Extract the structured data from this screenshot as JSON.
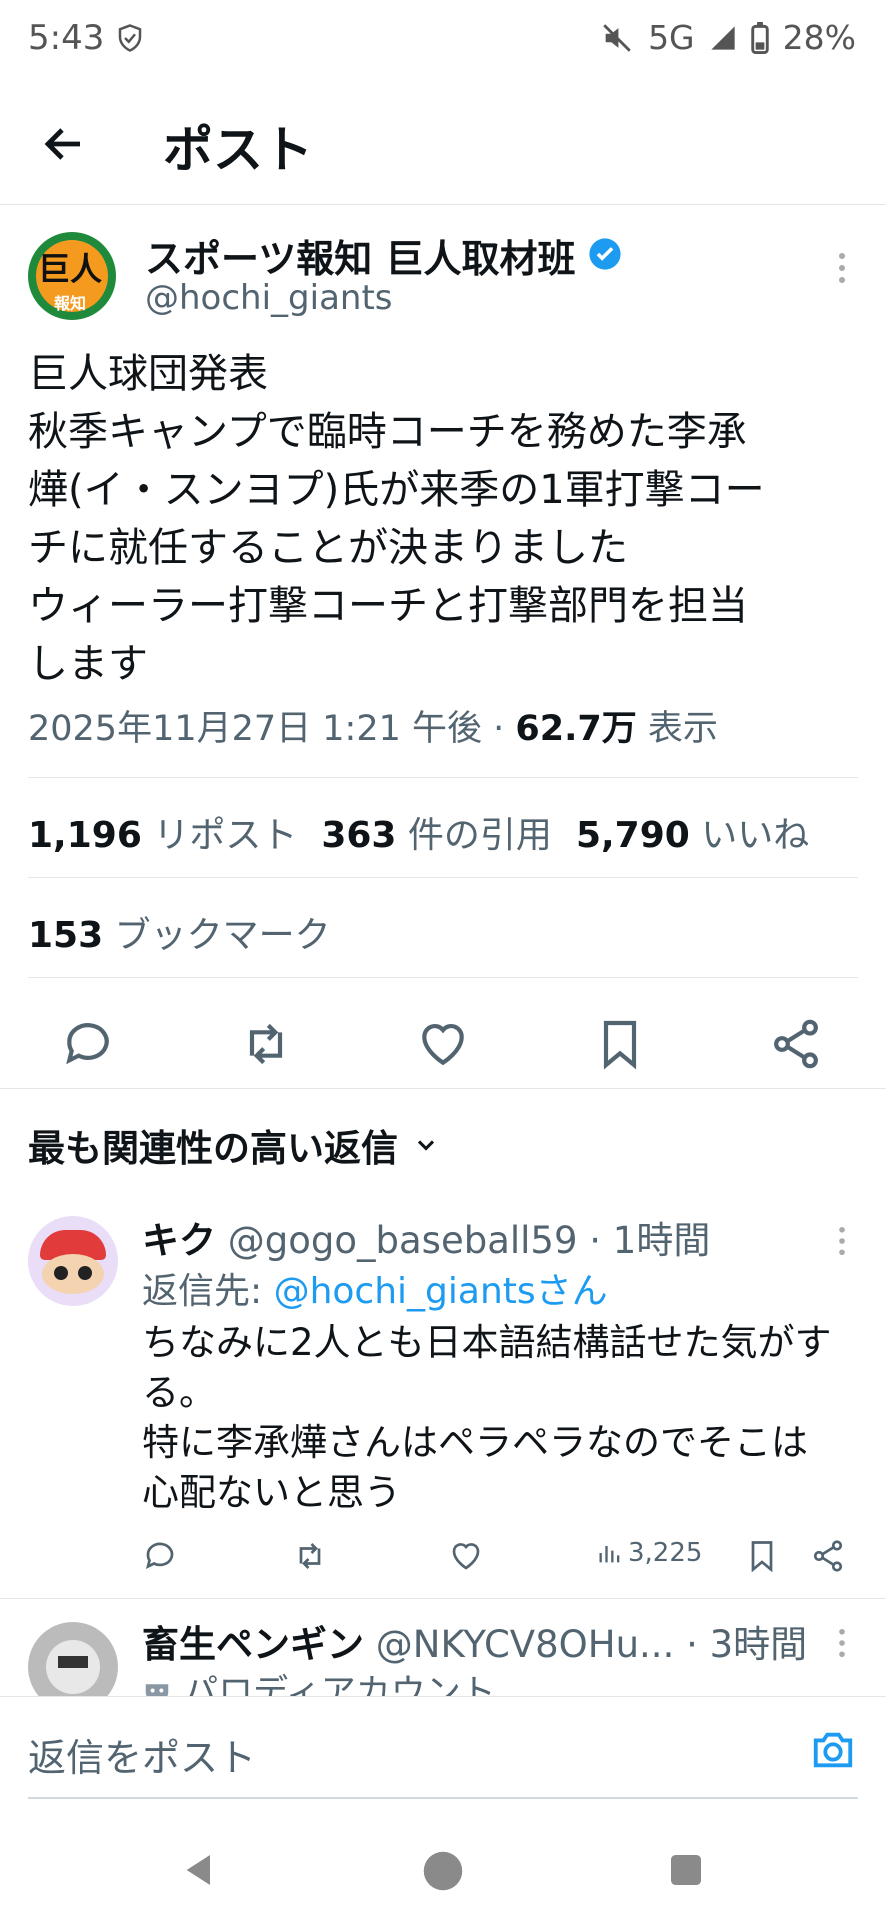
{
  "status_bar": {
    "time": "5:43",
    "network": "5G",
    "battery": "28%"
  },
  "header": {
    "title": "ポスト"
  },
  "post": {
    "author_name": "スポーツ報知 巨人取材班",
    "handle": "@hochi_giants",
    "avatar_text_top": "巨人",
    "avatar_text_bottom": "報知",
    "text": "巨人球団発表\n秋季キャンプで臨時コーチを務めた李承\n燁(イ・スンヨプ)氏が来季の1軍打撃コー\nチに就任することが決まりました\nウィーラー打撃コーチと打撃部門を担当\nします",
    "timestamp": "2025年11月27日 1:21 午後 · ",
    "views_count": "62.7万",
    "views_label": " 表示",
    "reposts_count": "1,196",
    "reposts_label": " リポスト",
    "quotes_count": "363",
    "quotes_label": " 件の引用",
    "likes_count": "5,790",
    "likes_label": " いいね",
    "bookmarks_count": "153",
    "bookmarks_label": " ブックマーク"
  },
  "sort": {
    "label": "最も関連性の高い返信"
  },
  "replies": [
    {
      "name": "キク",
      "handle_time": " @gogo_baseball59 · 1時間",
      "reply_to_label": "返信先: ",
      "reply_to_handle": "@hochi_giantsさん",
      "text": "ちなみに2人とも日本語結構話せた気がす\nる。\n特に李承燁さんはペラペラなのでそこは\n心配ないと思う",
      "views": "3,225"
    },
    {
      "name": "畜生ペンギン",
      "handle_time": " @NKYCV8OHu... · 3時間",
      "parody_label": "パロディアカウント"
    }
  ],
  "composer": {
    "placeholder": "返信をポスト"
  },
  "colors": {
    "accent": "#1d9bf0",
    "text": "#0f1419",
    "secondary": "#536471",
    "divider": "#e6e6e6"
  }
}
